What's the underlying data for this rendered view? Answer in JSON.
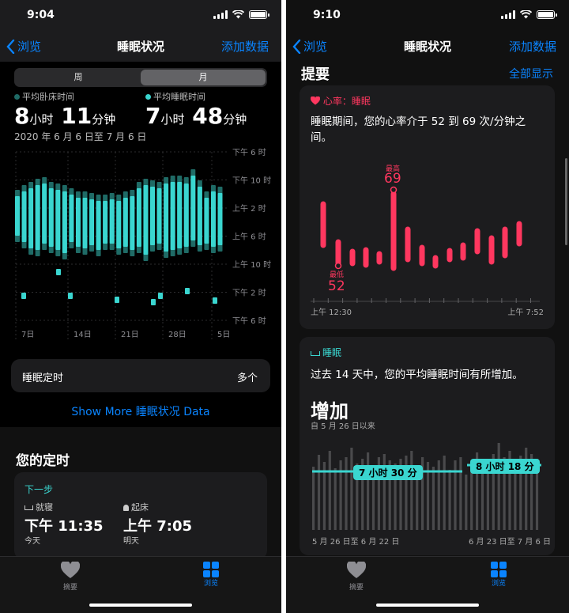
{
  "left": {
    "status_time": "9:04",
    "nav": {
      "back": "浏览",
      "title": "睡眠状况",
      "action": "添加数据"
    },
    "segments": [
      "周",
      "月"
    ],
    "legend": {
      "in_bed": "平均卧床时间",
      "asleep": "平均睡眠时间"
    },
    "in_bed": {
      "h": "8",
      "h_unit": "小时",
      "m": "11",
      "m_unit": "分钟"
    },
    "asleep": {
      "h": "7",
      "h_unit": "小时",
      "m": "48",
      "m_unit": "分钟"
    },
    "date_range": "2020 年 6 月 6 日至 7 月 6 日",
    "y_labels": [
      "下午 6 时",
      "下午 10 时",
      "上午 2 时",
      "上午 6 时",
      "上午 10 时",
      "下午 2 时",
      "下午 6 时"
    ],
    "x_labels": [
      "7日",
      "14日",
      "21日",
      "28日",
      "5日"
    ],
    "schedule_row": {
      "label": "睡眠定时",
      "value": "多个"
    },
    "show_more": "Show More 睡眠状况 Data",
    "schedule_title": "您的定时",
    "next_label": "下一步",
    "bedtime": {
      "label": "就寝",
      "time": "下午 11:35",
      "day": "今天"
    },
    "wake": {
      "label": "起床",
      "time": "上午 7:05",
      "day": "明天"
    }
  },
  "right": {
    "status_time": "9:10",
    "nav": {
      "back": "浏览",
      "title": "睡眠状况",
      "action": "添加数据"
    },
    "highlights": "提要",
    "show_all": "全部显示",
    "hr": {
      "tag": "心率：睡眠",
      "text": "睡眠期间，您的心率介于 52 到 69 次/分钟之间。",
      "max_label": "最高",
      "max_value": "69",
      "min_label": "最低",
      "min_value": "52",
      "x_start": "上午 12:30",
      "x_end": "上午 7:52"
    },
    "sleep": {
      "tag": "睡眠",
      "text": "过去 14 天中，您的平均睡眠时间有所增加。",
      "headline": "增加",
      "since": "自 5 月 26 日以来",
      "avg_old": "7 小时 30 分",
      "avg_new": "8 小时 18 分",
      "range_old": "5 月 26 日至 6 月 22 日",
      "range_new": "6 月 23 日至 7 月 6 日"
    }
  },
  "tabbar": {
    "summary": "摘要",
    "browse": "浏览"
  },
  "colors": {
    "accent": "#0a84ff",
    "sleep": "#3ad6d0",
    "heart": "#ff375f"
  }
}
